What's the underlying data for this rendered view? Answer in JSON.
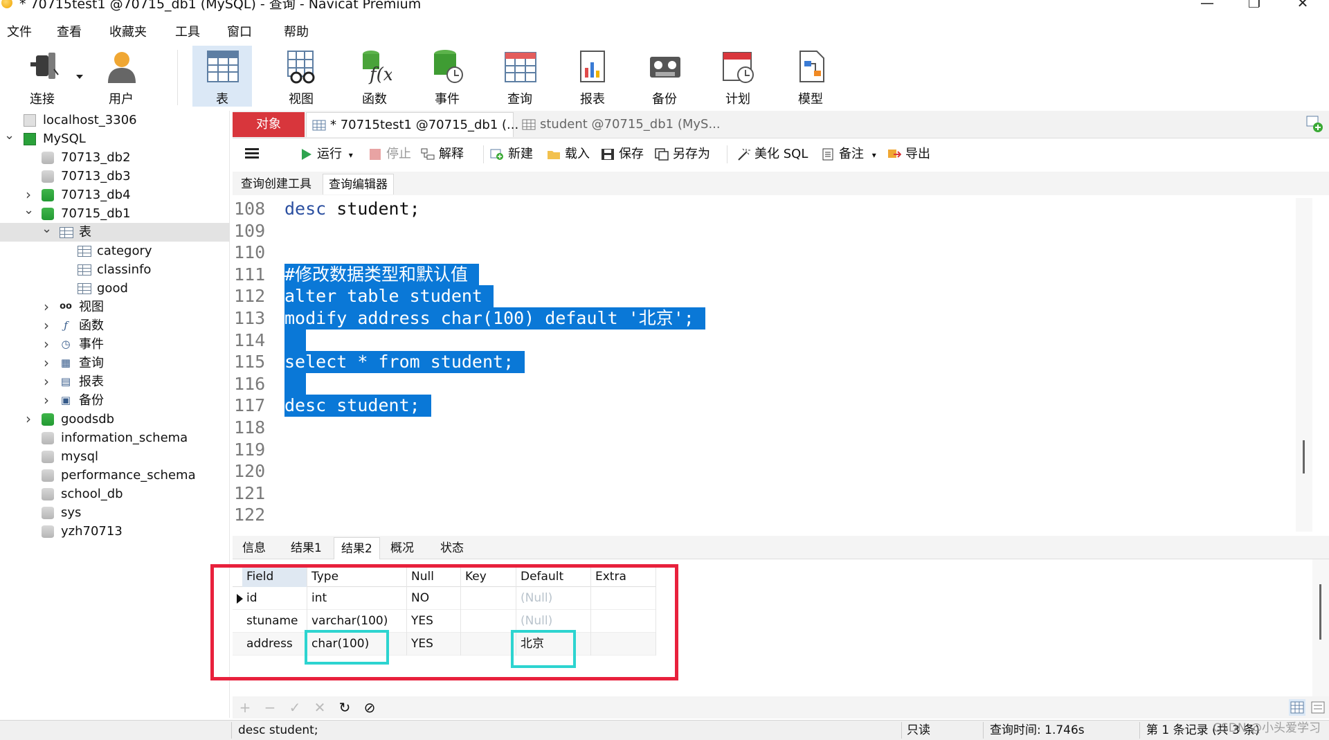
{
  "window": {
    "title": "* 70715test1 @70715_db1 (MySQL) - 查询 - Navicat Premium",
    "minimize": "—",
    "maximize": "❐",
    "close": "✕"
  },
  "menu": [
    "文件",
    "查看",
    "收藏夹",
    "工具",
    "窗口",
    "帮助"
  ],
  "toolbar": {
    "items": [
      {
        "label": "连接",
        "icon": "plug-icon"
      },
      {
        "label": "用户",
        "icon": "user-icon"
      },
      {
        "label": "表",
        "icon": "table-icon",
        "active": true
      },
      {
        "label": "视图",
        "icon": "view-icon"
      },
      {
        "label": "函数",
        "icon": "function-icon"
      },
      {
        "label": "事件",
        "icon": "event-icon"
      },
      {
        "label": "查询",
        "icon": "query-icon"
      },
      {
        "label": "报表",
        "icon": "report-icon"
      },
      {
        "label": "备份",
        "icon": "backup-icon"
      },
      {
        "label": "计划",
        "icon": "schedule-icon"
      },
      {
        "label": "模型",
        "icon": "model-icon"
      }
    ]
  },
  "tree": [
    {
      "label": "localhost_3306",
      "level": 0,
      "icon": "server-grey",
      "chevron": ""
    },
    {
      "label": "MySQL",
      "level": 0,
      "icon": "server-green",
      "chevron": "v"
    },
    {
      "label": "70713_db2",
      "level": 1,
      "icon": "db-grey",
      "chevron": ""
    },
    {
      "label": "70713_db3",
      "level": 1,
      "icon": "db-grey",
      "chevron": ""
    },
    {
      "label": "70713_db4",
      "level": 1,
      "icon": "db-green",
      "chevron": ">"
    },
    {
      "label": "70715_db1",
      "level": 1,
      "icon": "db-green",
      "chevron": "v"
    },
    {
      "label": "表",
      "level": 2,
      "icon": "table",
      "chevron": "v",
      "selected": true
    },
    {
      "label": "category",
      "level": 3,
      "icon": "table",
      "chevron": ""
    },
    {
      "label": "classinfo",
      "level": 3,
      "icon": "table",
      "chevron": ""
    },
    {
      "label": "good",
      "level": 3,
      "icon": "table",
      "chevron": ""
    },
    {
      "label": "视图",
      "level": 2,
      "icon": "view",
      "chevron": ">"
    },
    {
      "label": "函数",
      "level": 2,
      "icon": "function",
      "chevron": ">"
    },
    {
      "label": "事件",
      "level": 2,
      "icon": "event",
      "chevron": ">"
    },
    {
      "label": "查询",
      "level": 2,
      "icon": "query",
      "chevron": ">"
    },
    {
      "label": "报表",
      "level": 2,
      "icon": "report",
      "chevron": ">"
    },
    {
      "label": "备份",
      "level": 2,
      "icon": "backup",
      "chevron": ">"
    },
    {
      "label": "goodsdb",
      "level": 1,
      "icon": "db-green",
      "chevron": ">"
    },
    {
      "label": "information_schema",
      "level": 1,
      "icon": "db-grey",
      "chevron": ""
    },
    {
      "label": "mysql",
      "level": 1,
      "icon": "db-grey",
      "chevron": ""
    },
    {
      "label": "performance_schema",
      "level": 1,
      "icon": "db-grey",
      "chevron": ""
    },
    {
      "label": "school_db",
      "level": 1,
      "icon": "db-grey",
      "chevron": ""
    },
    {
      "label": "sys",
      "level": 1,
      "icon": "db-grey",
      "chevron": ""
    },
    {
      "label": "yzh70713",
      "level": 1,
      "icon": "db-grey",
      "chevron": ""
    }
  ],
  "tabs": {
    "objects": "对象",
    "query_tab": "* 70715test1 @70715_db1 (...",
    "table_tab": "student @70715_db1 (MyS..."
  },
  "query_toolbar": {
    "run": "运行",
    "stop": "停止",
    "explain": "解释",
    "new": "新建",
    "load": "载入",
    "save": "保存",
    "save_as": "另存为",
    "beautify": "美化 SQL",
    "note": "备注",
    "export": "导出"
  },
  "subtabs": [
    "查询创建工具",
    "查询编辑器"
  ],
  "editor": {
    "lines": [
      {
        "n": "108",
        "code": "desc student;",
        "sel": false
      },
      {
        "n": "109",
        "code": "",
        "sel": false
      },
      {
        "n": "110",
        "code": "",
        "sel": false
      },
      {
        "n": "111",
        "code": "#修改数据类型和默认值",
        "sel": true
      },
      {
        "n": "112",
        "code": "alter table student",
        "sel": true
      },
      {
        "n": "113",
        "code": "modify address char(100) default '北京';",
        "sel": true
      },
      {
        "n": "114",
        "code": "",
        "sel": true
      },
      {
        "n": "115",
        "code": "select * from student;",
        "sel": true
      },
      {
        "n": "116",
        "code": "",
        "sel": true
      },
      {
        "n": "117",
        "code": "desc student;",
        "sel": true
      },
      {
        "n": "118",
        "code": "",
        "sel": false
      },
      {
        "n": "119",
        "code": "",
        "sel": false
      },
      {
        "n": "120",
        "code": "",
        "sel": false
      },
      {
        "n": "121",
        "code": "",
        "sel": false
      },
      {
        "n": "122",
        "code": "",
        "sel": false
      }
    ]
  },
  "result_tabs": [
    "信息",
    "结果1",
    "结果2",
    "概况",
    "状态"
  ],
  "result_grid": {
    "columns": [
      "Field",
      "Type",
      "Null",
      "Key",
      "Default",
      "Extra"
    ],
    "rows": [
      [
        "id",
        "int",
        "NO",
        "",
        "(Null)",
        ""
      ],
      [
        "stuname",
        "varchar(100)",
        "YES",
        "",
        "(Null)",
        ""
      ],
      [
        "address",
        "char(100)",
        "YES",
        "",
        "北京",
        ""
      ]
    ]
  },
  "status": {
    "sql": "desc student;",
    "readonly": "只读",
    "query_time": "查询时间: 1.746s",
    "record": "第 1 条记录 (共 3 条)"
  },
  "watermark": "CSDN @小头爱学习",
  "colors": {
    "selection": "#0a78d7",
    "objects_tab": "#d8363c",
    "highlight_red": "#e8213c",
    "highlight_cyan": "#2dd4d0"
  }
}
